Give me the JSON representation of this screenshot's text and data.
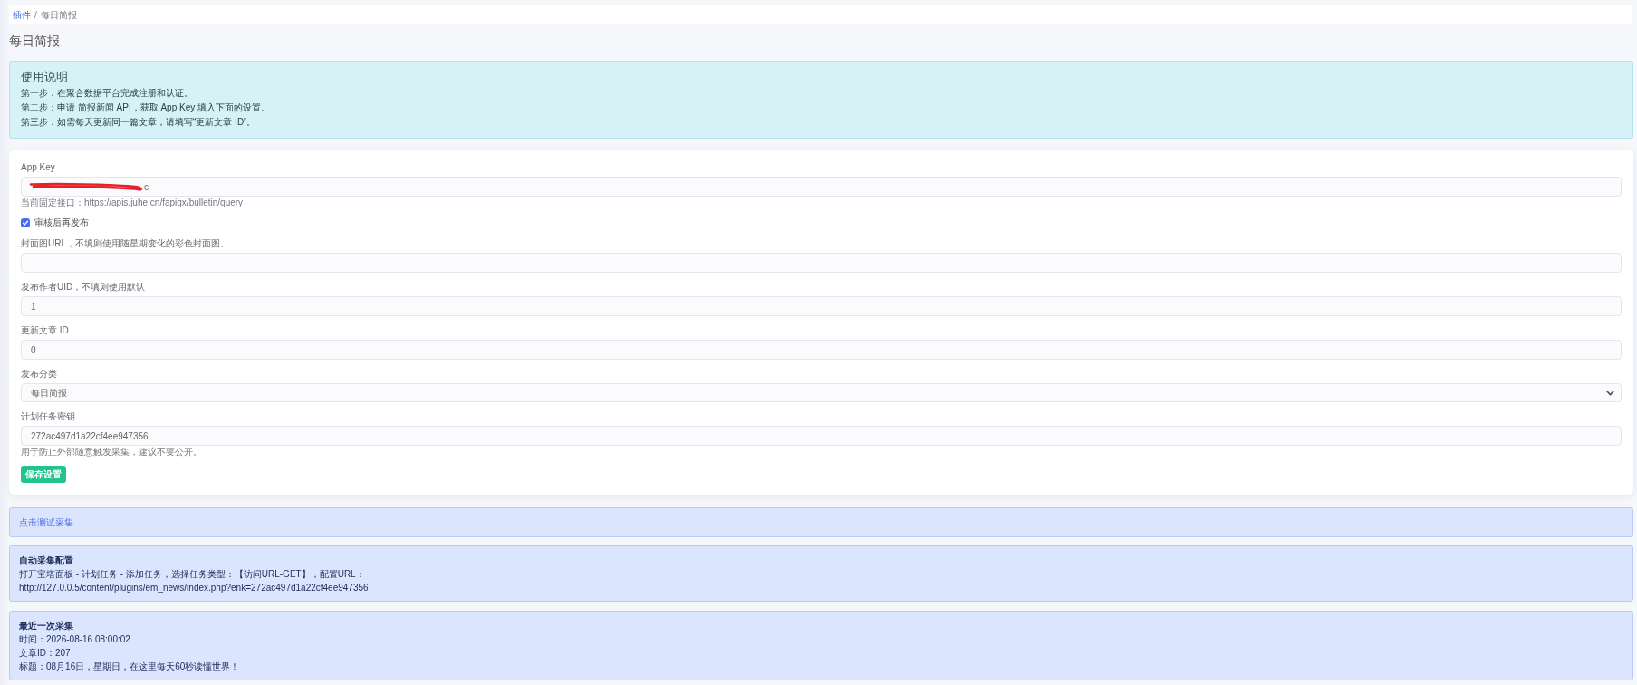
{
  "breadcrumb": {
    "separator": "/",
    "items": [
      {
        "label": "插件",
        "link": true
      },
      {
        "label": "每日简报",
        "link": false
      }
    ]
  },
  "page_title": "每日简报",
  "instructions": {
    "title": "使用说明",
    "lines": [
      "第一步：在聚合数据平台完成注册和认证。",
      "第二步：申请 简报新闻 API，获取 App Key 填入下面的设置。",
      "第三步：如需每天更新同一篇文章，请填写“更新文章 ID”。"
    ]
  },
  "form": {
    "fields": [
      {
        "kind": "text",
        "label": "App Key",
        "value": "c",
        "redacted": true,
        "help": "当前固定接口：https://apis.juhe.cn/fapigx/bulletin/query"
      },
      {
        "kind": "checkbox",
        "label": "审核后再发布",
        "checked": true
      },
      {
        "kind": "text",
        "label": "封面图URL，不填则使用随星期变化的彩色封面图。"
      },
      {
        "kind": "text",
        "label": "发布作者UID，不填则使用默认",
        "value": "1"
      },
      {
        "kind": "text",
        "label": "更新文章 ID",
        "value": "0"
      },
      {
        "kind": "select",
        "label": "发布分类",
        "value": "每日简报"
      },
      {
        "kind": "text",
        "label": "计划任务密钥",
        "value": "272ac497d1a22cf4ee947356",
        "help": "用于防止外部随意触发采集，建议不要公开。"
      }
    ],
    "submit": "保存设置"
  },
  "notices": [
    {
      "kind": "link",
      "text": "点击测试采集"
    },
    {
      "kind": "info",
      "title": "自动采集配置",
      "lines": [
        "打开宝塔面板 - 计划任务 - 添加任务，选择任务类型：【访问URL-GET】，配置URL：",
        "http://127.0.0.5/content/plugins/em_news/index.php?enk=272ac497d1a22cf4ee947356"
      ]
    },
    {
      "kind": "info",
      "title": "最近一次采集",
      "lines": [
        "时间：2026-08-16 08:00:02",
        "文章ID：207",
        "标题：08月16日，星期日，在这里每天60秒读懂世界！"
      ]
    }
  ]
}
